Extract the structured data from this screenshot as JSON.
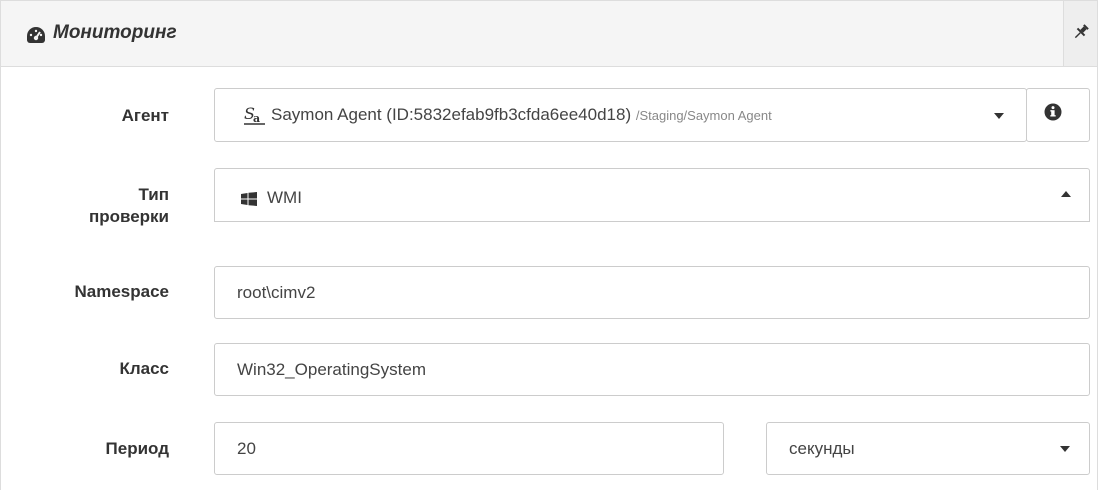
{
  "panel": {
    "title": "Мониторинг",
    "header_icon": "dashboard-icon",
    "pin_icon": "pushpin-icon"
  },
  "form": {
    "agent": {
      "label": "Агент",
      "value": "Saymon Agent (ID:5832efab9fb3cfda6ee40d18)",
      "path": "/Staging/Saymon Agent",
      "icon": "saymon-agent-icon",
      "info_icon": "info-circle-icon"
    },
    "check_type": {
      "label_line1": "Тип",
      "label_line2": "проверки",
      "value": "WMI",
      "icon": "windows-icon"
    },
    "namespace": {
      "label": "Namespace",
      "value": "root\\cimv2"
    },
    "class": {
      "label": "Класс",
      "value": "Win32_OperatingSystem"
    },
    "period": {
      "label": "Период",
      "value": "20",
      "unit": "секунды"
    }
  }
}
